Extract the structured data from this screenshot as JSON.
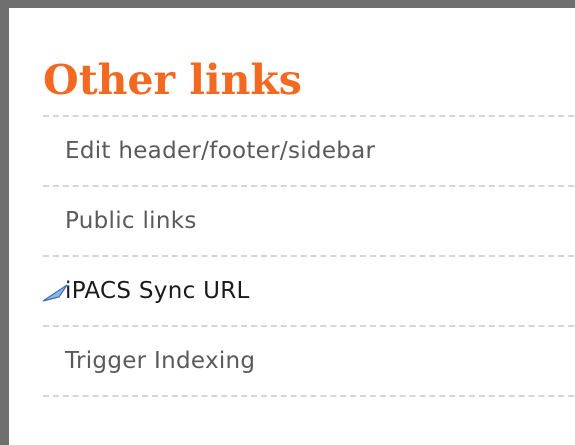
{
  "section": {
    "title": "Other links",
    "title_color": "#f26a22"
  },
  "links": [
    {
      "label": "Edit header/footer/sidebar"
    },
    {
      "label": "Public links"
    },
    {
      "label": "iPACS Sync URL"
    },
    {
      "label": "Trigger Indexing"
    }
  ],
  "colors": {
    "link_text": "#5a5a5a",
    "active_link_text": "#1a1a1a",
    "frame_border": "#6f6f6f",
    "divider": "#d6d6d6"
  },
  "icons": {
    "pointer": "mouse-cursor-arrow-icon"
  }
}
